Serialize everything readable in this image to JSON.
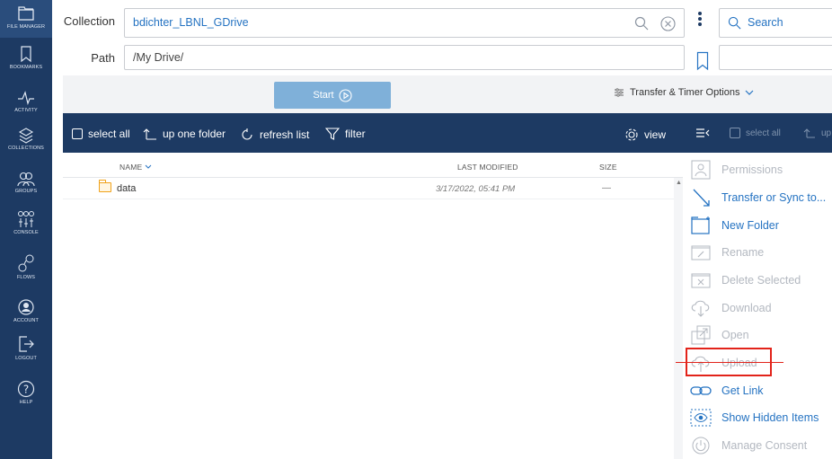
{
  "nav": {
    "items": [
      {
        "label": "FILE MANAGER",
        "icon": "folder-icon"
      },
      {
        "label": "BOOKMARKS",
        "icon": "bookmark-icon"
      },
      {
        "label": "ACTIVITY",
        "icon": "activity-icon"
      },
      {
        "label": "COLLECTIONS",
        "icon": "collections-icon"
      },
      {
        "label": "GROUPS",
        "icon": "groups-icon"
      },
      {
        "label": "CONSOLE",
        "icon": "console-icon"
      },
      {
        "label": "FLOWS",
        "icon": "flows-icon"
      },
      {
        "label": "ACCOUNT",
        "icon": "account-icon"
      },
      {
        "label": "LOGOUT",
        "icon": "logout-icon"
      },
      {
        "label": "HELP",
        "icon": "help-icon"
      }
    ]
  },
  "collection": {
    "label": "Collection",
    "value": "bdichter_LBNL_GDrive"
  },
  "path": {
    "label": "Path",
    "value": "/My Drive/"
  },
  "search": {
    "placeholder": "Search"
  },
  "start": {
    "label": "Start"
  },
  "options": {
    "label": "Transfer & Timer Options"
  },
  "toolbar": {
    "select_all": "select all",
    "up_one_folder": "up one folder",
    "refresh_list": "refresh list",
    "filter": "filter",
    "view": "view"
  },
  "toolbar2": {
    "select_all": "select all",
    "up": "up"
  },
  "table": {
    "headers": {
      "name": "NAME",
      "modified": "LAST MODIFIED",
      "size": "SIZE"
    },
    "rows": [
      {
        "name": "data",
        "modified": "3/17/2022, 05:41 PM",
        "size": "—"
      }
    ]
  },
  "menu": [
    {
      "label": "Permissions",
      "enabled": false,
      "icon": "permissions-icon"
    },
    {
      "label": "Transfer or Sync to...",
      "enabled": true,
      "icon": "transfer-icon"
    },
    {
      "label": "New Folder",
      "enabled": true,
      "icon": "new-folder-icon"
    },
    {
      "label": "Rename",
      "enabled": false,
      "icon": "rename-icon"
    },
    {
      "label": "Delete Selected",
      "enabled": false,
      "icon": "delete-icon"
    },
    {
      "label": "Download",
      "enabled": false,
      "icon": "download-icon"
    },
    {
      "label": "Open",
      "enabled": false,
      "icon": "open-icon"
    },
    {
      "label": "Upload",
      "enabled": false,
      "icon": "upload-icon"
    },
    {
      "label": "Get Link",
      "enabled": true,
      "icon": "link-icon"
    },
    {
      "label": "Show Hidden Items",
      "enabled": true,
      "icon": "eye-icon"
    },
    {
      "label": "Manage Consent",
      "enabled": false,
      "icon": "consent-icon"
    }
  ],
  "colors": {
    "nav_bg": "#1d3a63",
    "accent": "#2573c2",
    "start_btn": "#7fb0d9",
    "highlight": "#e2231a"
  }
}
